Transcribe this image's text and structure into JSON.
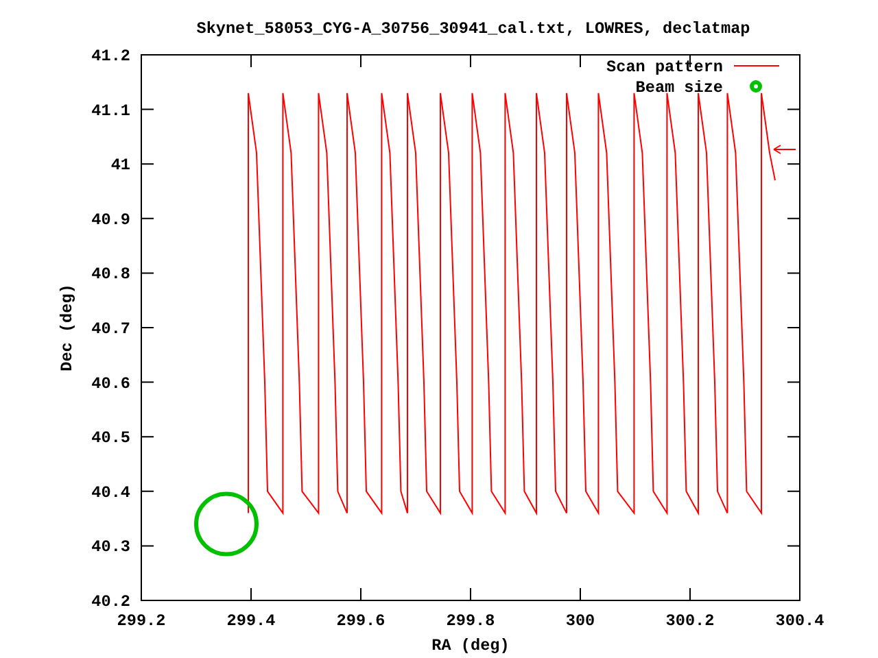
{
  "chart_data": {
    "type": "line",
    "title": "Skynet_58053_CYG-A_30756_30941_cal.txt, LOWRES, declatmap",
    "xlabel": "RA (deg)",
    "ylabel": "Dec (deg)",
    "xlim": [
      299.2,
      300.4
    ],
    "ylim": [
      40.2,
      41.2
    ],
    "xticks": [
      {
        "value": 299.2,
        "label": "299.2"
      },
      {
        "value": 299.4,
        "label": "299.4"
      },
      {
        "value": 299.6,
        "label": "299.6"
      },
      {
        "value": 299.8,
        "label": "299.8"
      },
      {
        "value": 300,
        "label": "300"
      },
      {
        "value": 300.2,
        "label": "300.2"
      },
      {
        "value": 300.4,
        "label": "300.4"
      }
    ],
    "yticks": [
      {
        "value": 40.2,
        "label": "40.2"
      },
      {
        "value": 40.3,
        "label": "40.3"
      },
      {
        "value": 40.4,
        "label": "40.4"
      },
      {
        "value": 40.5,
        "label": "40.5"
      },
      {
        "value": 40.6,
        "label": "40.6"
      },
      {
        "value": 40.7,
        "label": "40.7"
      },
      {
        "value": 40.8,
        "label": "40.8"
      },
      {
        "value": 40.9,
        "label": "40.9"
      },
      {
        "value": 41,
        "label": "41"
      },
      {
        "value": 41.1,
        "label": "41.1"
      },
      {
        "value": 41.2,
        "label": "41.2"
      }
    ],
    "x": [
      299.395,
      299.395,
      299.41,
      299.425,
      299.43,
      299.458,
      299.458,
      299.473,
      299.488,
      299.493,
      299.523,
      299.523,
      299.538,
      299.553,
      299.558,
      299.575,
      299.575,
      299.59,
      299.605,
      299.61,
      299.638,
      299.638,
      299.653,
      299.668,
      299.673,
      299.685,
      299.685,
      299.7,
      299.715,
      299.72,
      299.745,
      299.745,
      299.76,
      299.775,
      299.78,
      299.803,
      299.803,
      299.818,
      299.833,
      299.838,
      299.863,
      299.863,
      299.878,
      299.893,
      299.898,
      299.92,
      299.92,
      299.935,
      299.95,
      299.955,
      299.975,
      299.975,
      299.99,
      300.005,
      300.01,
      300.033,
      300.033,
      300.048,
      300.063,
      300.068,
      300.098,
      300.098,
      300.113,
      300.128,
      300.133,
      300.158,
      300.158,
      300.173,
      300.188,
      300.193,
      300.215,
      300.215,
      300.23,
      300.245,
      300.25,
      300.268,
      300.268,
      300.283,
      300.298,
      300.303,
      300.33,
      300.33,
      300.345,
      300.355
    ],
    "series": [
      {
        "name": "Scan pattern",
        "color": "#ff0000",
        "values": [
          40.36,
          41.13,
          41.02,
          40.6,
          40.4,
          40.36,
          41.13,
          41.02,
          40.6,
          40.4,
          40.36,
          41.13,
          41.02,
          40.6,
          40.4,
          40.36,
          41.13,
          41.02,
          40.6,
          40.4,
          40.36,
          41.13,
          41.02,
          40.6,
          40.4,
          40.36,
          41.13,
          41.02,
          40.6,
          40.4,
          40.36,
          41.13,
          41.02,
          40.6,
          40.4,
          40.36,
          41.13,
          41.02,
          40.6,
          40.4,
          40.36,
          41.13,
          41.02,
          40.6,
          40.4,
          40.36,
          41.13,
          41.02,
          40.6,
          40.4,
          40.36,
          41.13,
          41.02,
          40.6,
          40.4,
          40.36,
          41.13,
          41.02,
          40.6,
          40.4,
          40.36,
          41.13,
          41.02,
          40.6,
          40.4,
          40.36,
          41.13,
          41.02,
          40.6,
          40.4,
          40.36,
          41.13,
          41.02,
          40.6,
          40.4,
          40.36,
          41.13,
          41.02,
          40.6,
          40.4,
          40.36,
          41.13,
          41.02,
          40.97
        ]
      }
    ],
    "legend": [
      {
        "label": "Beam size",
        "color": "#00c000",
        "kind": "marker"
      }
    ]
  }
}
